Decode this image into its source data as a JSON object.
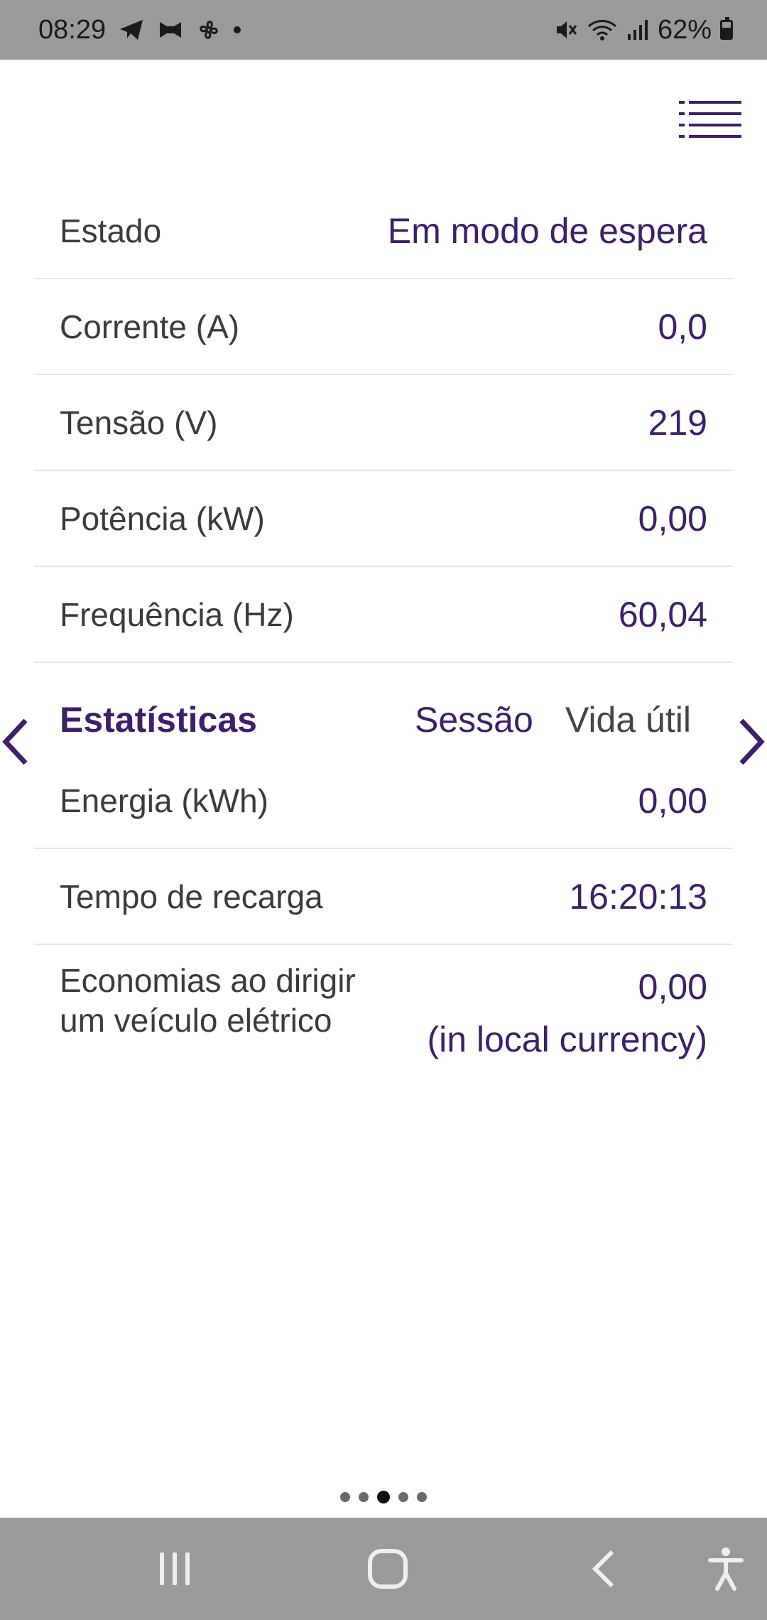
{
  "status_bar": {
    "time": "08:29",
    "battery": "62%",
    "battery_level": 0.62,
    "icons_left": [
      "telegram-icon",
      "app-icon",
      "fan-icon",
      "notification-dot"
    ],
    "icons_right": [
      "mute-icon",
      "wifi-icon",
      "signal-icon",
      "battery-icon"
    ]
  },
  "header": {
    "menu_icon": "menu-list-icon"
  },
  "readings": [
    {
      "label": "Estado",
      "value": "Em modo de espera"
    },
    {
      "label": "Corrente (A)",
      "value": "0,0"
    },
    {
      "label": "Tensão (V)",
      "value": "219"
    },
    {
      "label": "Potência (kW)",
      "value": "0,00"
    },
    {
      "label": "Frequência (Hz)",
      "value": "60,04"
    }
  ],
  "statistics": {
    "title": "Estatísticas",
    "tab_session": "Sessão",
    "tab_lifetime": "Vida útil",
    "active_tab": "Sessão",
    "rows": [
      {
        "label": "Energia (kWh)",
        "value": "0,00"
      },
      {
        "label": "Tempo de recarga",
        "value": "16:20:13"
      }
    ],
    "savings": {
      "label_line1": "Economias ao dirigir",
      "label_line2": "um veículo elétrico",
      "value_line1": "0,00",
      "value_line2": "(in local currency)"
    }
  },
  "pager": {
    "count": 5,
    "active_index": 2
  },
  "nav_bar": {
    "buttons": [
      "recents-icon",
      "home-icon",
      "back-icon",
      "accessibility-icon"
    ]
  },
  "colors": {
    "accent": "#3d1f6b",
    "status_bar_bg": "#9a9a9a",
    "label_text": "#3b3b3b"
  }
}
